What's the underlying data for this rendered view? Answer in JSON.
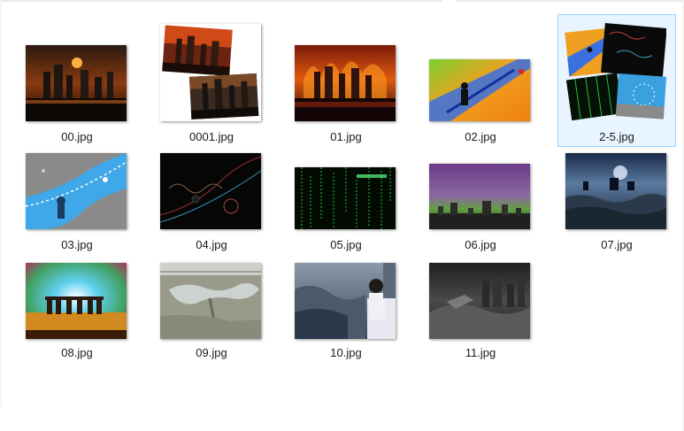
{
  "files": [
    {
      "name": "00.jpg"
    },
    {
      "name": "0001.jpg"
    },
    {
      "name": "01.jpg"
    },
    {
      "name": "02.jpg"
    },
    {
      "name": "2-5.jpg",
      "selected": true
    },
    {
      "name": "03.jpg"
    },
    {
      "name": "04.jpg"
    },
    {
      "name": "05.jpg"
    },
    {
      "name": "06.jpg"
    },
    {
      "name": "07.jpg"
    },
    {
      "name": "08.jpg"
    },
    {
      "name": "09.jpg"
    },
    {
      "name": "10.jpg"
    },
    {
      "name": "11.jpg"
    }
  ],
  "colors": {
    "selection_border": "#99d1ff",
    "selection_fill": "#e8f4ff"
  }
}
